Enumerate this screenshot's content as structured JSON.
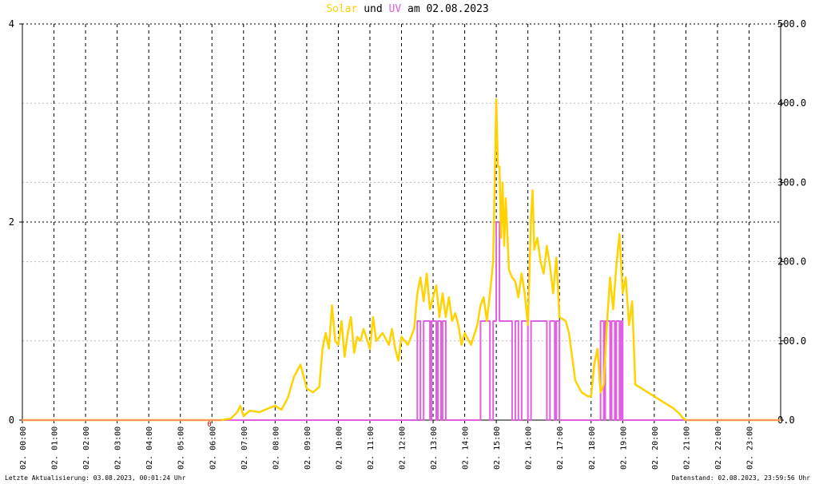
{
  "title": {
    "solar_word": "Solar",
    "und_word": "und",
    "uv_word": "UV",
    "rest": "am 02.08.2023",
    "solar_color": "#ffd200",
    "uv_color": "#e060e0"
  },
  "footer": {
    "left": "Letzte Aktualisierung: 03.08.2023, 00:01:24 Uhr",
    "right": "Datenstand: 02.08.2023, 23:59:56 Uhr"
  },
  "chart_data": {
    "type": "line",
    "title": "Solar und UV am 02.08.2023",
    "x_unit": "hour",
    "xlim": [
      0,
      24
    ],
    "x_tick_labels": [
      "02. 00:00",
      "02. 01:00",
      "02. 02:00",
      "02. 03:00",
      "02. 04:00",
      "02. 05:00",
      "02. 06:00",
      "02. 07:00",
      "02. 08:00",
      "02. 09:00",
      "02. 10:00",
      "02. 11:00",
      "02. 12:00",
      "02. 13:00",
      "02. 14:00",
      "02. 15:00",
      "02. 16:00",
      "02. 17:00",
      "02. 18:00",
      "02. 19:00",
      "02. 20:00",
      "02. 21:00",
      "02. 22:00",
      "02. 23:00"
    ],
    "y_left": {
      "ylim": [
        0,
        4
      ],
      "tick_labels": [
        "0",
        "2",
        "4"
      ]
    },
    "y_right": {
      "ylim": [
        0,
        500
      ],
      "tick_labels": [
        "0.0",
        "100.0",
        "200.0",
        "300.0",
        "400.0",
        "500.0"
      ]
    },
    "grid": true,
    "marker_label": "0",
    "series": [
      {
        "name": "Solar",
        "axis": "right",
        "color": "#ffd200",
        "points": [
          [
            0,
            0
          ],
          [
            6.3,
            0
          ],
          [
            6.6,
            2
          ],
          [
            6.8,
            10
          ],
          [
            6.9,
            18
          ],
          [
            7.0,
            5
          ],
          [
            7.2,
            12
          ],
          [
            7.5,
            10
          ],
          [
            7.8,
            15
          ],
          [
            8.0,
            18
          ],
          [
            8.2,
            13
          ],
          [
            8.4,
            28
          ],
          [
            8.6,
            55
          ],
          [
            8.8,
            70
          ],
          [
            9.0,
            40
          ],
          [
            9.2,
            35
          ],
          [
            9.4,
            42
          ],
          [
            9.5,
            90
          ],
          [
            9.6,
            110
          ],
          [
            9.7,
            90
          ],
          [
            9.8,
            145
          ],
          [
            9.9,
            100
          ],
          [
            10.0,
            95
          ],
          [
            10.1,
            125
          ],
          [
            10.2,
            80
          ],
          [
            10.3,
            110
          ],
          [
            10.4,
            130
          ],
          [
            10.5,
            85
          ],
          [
            10.6,
            105
          ],
          [
            10.7,
            100
          ],
          [
            10.8,
            115
          ],
          [
            11.0,
            90
          ],
          [
            11.1,
            130
          ],
          [
            11.2,
            100
          ],
          [
            11.4,
            110
          ],
          [
            11.6,
            95
          ],
          [
            11.7,
            115
          ],
          [
            11.8,
            90
          ],
          [
            11.9,
            75
          ],
          [
            12.0,
            105
          ],
          [
            12.2,
            95
          ],
          [
            12.4,
            115
          ],
          [
            12.5,
            160
          ],
          [
            12.6,
            180
          ],
          [
            12.7,
            150
          ],
          [
            12.8,
            185
          ],
          [
            12.9,
            140
          ],
          [
            13.0,
            155
          ],
          [
            13.1,
            170
          ],
          [
            13.2,
            130
          ],
          [
            13.3,
            160
          ],
          [
            13.4,
            130
          ],
          [
            13.5,
            155
          ],
          [
            13.6,
            125
          ],
          [
            13.7,
            135
          ],
          [
            13.8,
            120
          ],
          [
            13.9,
            95
          ],
          [
            14.0,
            110
          ],
          [
            14.2,
            95
          ],
          [
            14.4,
            120
          ],
          [
            14.5,
            145
          ],
          [
            14.6,
            155
          ],
          [
            14.7,
            125
          ],
          [
            14.8,
            160
          ],
          [
            14.9,
            200
          ],
          [
            15.0,
            405
          ],
          [
            15.05,
            320
          ],
          [
            15.1,
            320
          ],
          [
            15.15,
            230
          ],
          [
            15.2,
            300
          ],
          [
            15.25,
            220
          ],
          [
            15.3,
            280
          ],
          [
            15.4,
            190
          ],
          [
            15.5,
            180
          ],
          [
            15.6,
            175
          ],
          [
            15.7,
            155
          ],
          [
            15.8,
            185
          ],
          [
            15.9,
            160
          ],
          [
            16.0,
            120
          ],
          [
            16.1,
            255
          ],
          [
            16.15,
            290
          ],
          [
            16.2,
            215
          ],
          [
            16.3,
            230
          ],
          [
            16.4,
            200
          ],
          [
            16.5,
            185
          ],
          [
            16.6,
            220
          ],
          [
            16.7,
            195
          ],
          [
            16.8,
            160
          ],
          [
            16.9,
            205
          ],
          [
            17.0,
            130
          ],
          [
            17.2,
            125
          ],
          [
            17.3,
            110
          ],
          [
            17.4,
            80
          ],
          [
            17.5,
            50
          ],
          [
            17.7,
            35
          ],
          [
            17.9,
            30
          ],
          [
            18.0,
            30
          ],
          [
            18.1,
            70
          ],
          [
            18.2,
            90
          ],
          [
            18.3,
            35
          ],
          [
            18.4,
            45
          ],
          [
            18.5,
            120
          ],
          [
            18.6,
            180
          ],
          [
            18.7,
            140
          ],
          [
            18.8,
            195
          ],
          [
            18.9,
            235
          ],
          [
            19.0,
            160
          ],
          [
            19.1,
            180
          ],
          [
            19.2,
            120
          ],
          [
            19.3,
            150
          ],
          [
            19.4,
            45
          ],
          [
            19.6,
            40
          ],
          [
            19.8,
            35
          ],
          [
            20.0,
            30
          ],
          [
            20.2,
            25
          ],
          [
            20.4,
            20
          ],
          [
            20.6,
            15
          ],
          [
            20.8,
            8
          ],
          [
            20.9,
            3
          ],
          [
            21.0,
            0
          ],
          [
            24,
            0
          ]
        ]
      },
      {
        "name": "UV",
        "axis": "left",
        "color": "#e060e0",
        "points": [
          [
            0,
            0
          ],
          [
            12.5,
            0
          ],
          [
            12.5,
            1
          ],
          [
            12.6,
            1
          ],
          [
            12.6,
            0
          ],
          [
            12.7,
            0
          ],
          [
            12.7,
            1
          ],
          [
            12.9,
            1
          ],
          [
            12.9,
            0
          ],
          [
            12.95,
            0
          ],
          [
            12.95,
            1
          ],
          [
            13.1,
            1
          ],
          [
            13.1,
            0
          ],
          [
            13.15,
            0
          ],
          [
            13.15,
            1
          ],
          [
            13.25,
            1
          ],
          [
            13.25,
            0
          ],
          [
            13.3,
            0
          ],
          [
            13.3,
            1
          ],
          [
            13.4,
            1
          ],
          [
            13.4,
            0
          ],
          [
            14.5,
            0
          ],
          [
            14.5,
            1
          ],
          [
            14.8,
            1
          ],
          [
            14.8,
            0
          ],
          [
            14.9,
            0
          ],
          [
            14.9,
            1
          ],
          [
            15.0,
            1
          ],
          [
            15.0,
            2
          ],
          [
            15.1,
            2
          ],
          [
            15.1,
            1
          ],
          [
            15.5,
            1
          ],
          [
            15.5,
            0
          ],
          [
            15.6,
            0
          ],
          [
            15.6,
            1
          ],
          [
            15.7,
            1
          ],
          [
            15.7,
            0
          ],
          [
            15.8,
            0
          ],
          [
            15.8,
            1
          ],
          [
            16.0,
            1
          ],
          [
            16.0,
            0
          ],
          [
            16.1,
            0
          ],
          [
            16.1,
            1
          ],
          [
            16.6,
            1
          ],
          [
            16.6,
            0
          ],
          [
            16.7,
            0
          ],
          [
            16.7,
            1
          ],
          [
            16.85,
            1
          ],
          [
            16.85,
            0
          ],
          [
            16.9,
            0
          ],
          [
            16.9,
            1
          ],
          [
            17.0,
            1
          ],
          [
            17.0,
            0
          ],
          [
            18.3,
            0
          ],
          [
            18.3,
            1
          ],
          [
            18.4,
            1
          ],
          [
            18.4,
            0
          ],
          [
            18.45,
            0
          ],
          [
            18.45,
            1
          ],
          [
            18.6,
            1
          ],
          [
            18.6,
            0
          ],
          [
            18.65,
            0
          ],
          [
            18.65,
            1
          ],
          [
            18.75,
            1
          ],
          [
            18.75,
            0
          ],
          [
            18.8,
            0
          ],
          [
            18.8,
            1
          ],
          [
            18.9,
            1
          ],
          [
            18.9,
            0
          ],
          [
            18.95,
            0
          ],
          [
            18.95,
            1
          ],
          [
            19.0,
            1
          ],
          [
            19.0,
            0
          ],
          [
            24,
            0
          ]
        ]
      }
    ]
  }
}
